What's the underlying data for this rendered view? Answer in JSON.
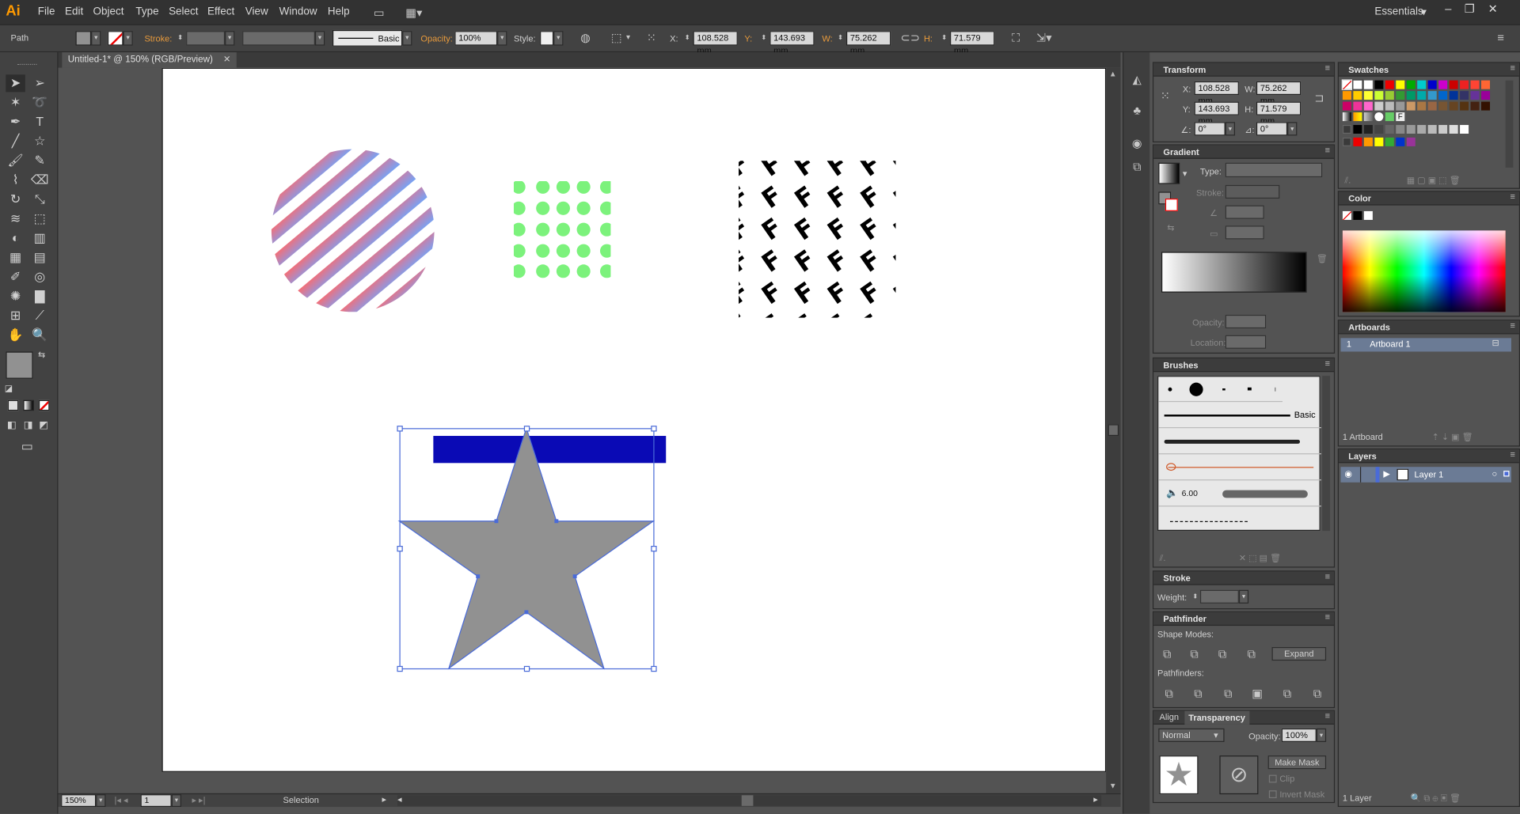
{
  "app": {
    "logo": "Ai",
    "menus": [
      "File",
      "Edit",
      "Object",
      "Type",
      "Select",
      "Effect",
      "View",
      "Window",
      "Help"
    ],
    "workspace": "Essentials"
  },
  "control": {
    "selection_type": "Path",
    "stroke_label": "Stroke:",
    "stroke_weight_label": "Basic",
    "opacity_label": "Opacity:",
    "opacity": "100%",
    "style_label": "Style:",
    "x_label": "X:",
    "x": "108.528 mm",
    "y_label": "Y:",
    "y": "143.693 mm",
    "w_label": "W:",
    "w": "75.262 mm",
    "h_label": "H:",
    "h": "71.579 mm"
  },
  "document": {
    "tab": "Untitled-1* @ 150% (RGB/Preview)"
  },
  "status": {
    "zoom": "150%",
    "artboard": "1",
    "tool": "Selection"
  },
  "transform": {
    "title": "Transform",
    "x_label": "X:",
    "x": "108.528 mm",
    "y_label": "Y:",
    "y": "143.693 mm",
    "w_label": "W:",
    "w": "75.262 mm",
    "h_label": "H:",
    "h": "71.579 mm",
    "angle": "0°",
    "shear": "0°"
  },
  "gradient": {
    "title": "Gradient",
    "type_label": "Type:",
    "stroke_label": "Stroke:",
    "opacity_label": "Opacity:",
    "location_label": "Location:"
  },
  "brushes": {
    "title": "Brushes",
    "basic": "Basic",
    "size": "6.00"
  },
  "stroke": {
    "title": "Stroke",
    "weight_label": "Weight:"
  },
  "pathfinder": {
    "title": "Pathfinder",
    "shape_modes": "Shape Modes:",
    "pathfinders": "Pathfinders:",
    "expand": "Expand"
  },
  "transparency": {
    "align_tab": "Align",
    "title": "Transparency",
    "blend": "Normal",
    "opacity_label": "Opacity:",
    "opacity": "100%",
    "make_mask": "Make Mask",
    "clip": "Clip",
    "invert_mask": "Invert Mask"
  },
  "swatches": {
    "title": "Swatches"
  },
  "color": {
    "title": "Color"
  },
  "artboards": {
    "title": "Artboards",
    "item_num": "1",
    "item_name": "Artboard 1",
    "count": "1 Artboard"
  },
  "layers": {
    "title": "Layers",
    "layer_name": "Layer 1",
    "count": "1 Layer"
  },
  "colors": {
    "star_fill": "#919191",
    "blue_bar": "#0a0ab5",
    "dots": "#7cf27c",
    "selection": "#4a6bd8"
  }
}
